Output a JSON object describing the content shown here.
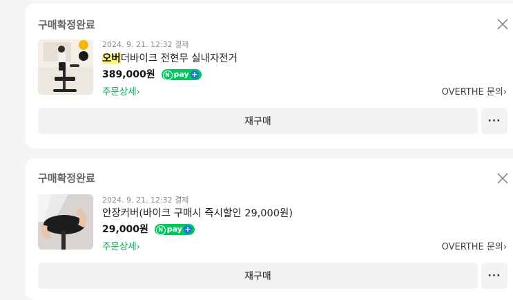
{
  "orders": [
    {
      "status": "구매확정완료",
      "date": "2024. 9. 21. 12:32 결제",
      "product_highlight": "오버",
      "product_rest": "더바이크 전현무 실내자전거",
      "price": "389,000원",
      "npay_label": "pay",
      "detail_link": "주문상세›",
      "seller": "OVERTHE 문의›",
      "rebuy_label": "재구매",
      "more_label": "···"
    },
    {
      "status": "구매확정완료",
      "date": "2024. 9. 21. 12:32 결제",
      "product_name": "안장커버(바이크 구매시 즉시할인 29,000원)",
      "price": "29,000원",
      "npay_label": "pay",
      "detail_link": "주문상세›",
      "seller": "OVERTHE 문의›",
      "rebuy_label": "재구매",
      "more_label": "···"
    }
  ],
  "icons": {
    "close": "close-icon",
    "npay": "npay-logo",
    "more": "more-icon"
  },
  "colors": {
    "accent_green": "#03c75a",
    "highlight_yellow": "#fff27a",
    "link_green": "#03a94f"
  }
}
